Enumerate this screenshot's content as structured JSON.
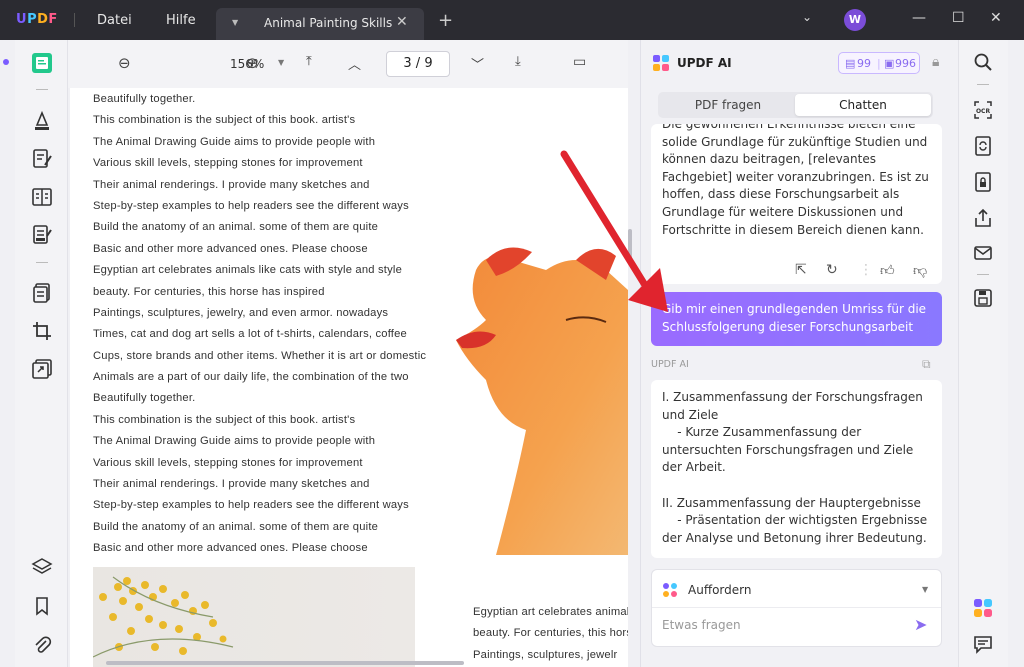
{
  "app": {
    "logo": "UPDF",
    "menus": [
      "Datei",
      "Hilfe"
    ],
    "tab_title": "Animal Painting Skills",
    "avatar_letter": "W"
  },
  "doc_toolbar": {
    "zoom": "156%",
    "page_indicator": "3 / 9"
  },
  "document": {
    "lines": [
      "Beautifully together.",
      "This combination is the subject of this book. artist's",
      "The Animal Drawing Guide aims to provide people with",
      "Various skill levels, stepping stones for improvement",
      "Their animal renderings. I provide many sketches and",
      "Step-by-step examples to help readers see the different ways",
      "Build the anatomy of an animal. some of them are quite",
      "Basic and other more advanced ones. Please choose",
      "Egyptian art celebrates animals like cats with style and style",
      "beauty. For centuries, this horse has inspired",
      "Paintings, sculptures, jewelry, and even armor. nowadays",
      "Times, cat and dog art sells a lot of t-shirts, calendars, coffee",
      "Cups, store brands and other items. Whether it is art or domestic",
      "Animals are a part of our daily life, the combination of the two",
      "Beautifully together.",
      "This combination is the subject of this book. artist's",
      "The Animal Drawing Guide aims to provide people with",
      "Various skill levels, stepping stones for improvement",
      "Their animal renderings. I provide many sketches and",
      "Step-by-step examples to help readers see the different ways",
      "Build the anatomy of an animal. some of them are quite",
      "Basic and other more advanced ones. Please choose"
    ],
    "col2_lines": [
      "Egyptian art celebrates animal",
      "beauty. For centuries, this hors",
      "Paintings, sculptures, jewelr"
    ]
  },
  "ai_panel": {
    "title": "UPDF AI",
    "quota_pdf": "99",
    "quota_chat": "996",
    "tabs": [
      "PDF fragen",
      "Chatten"
    ],
    "active_tab": "Chatten",
    "answer1": "Die gewonnenen Erkenntnisse bieten eine solide Grundlage für zukünftige Studien und können dazu beitragen, [relevantes Fachgebiet] weiter voranzubringen. Es ist zu hoffen, dass diese Forschungsarbeit als Grundlage für weitere Diskussionen und Fortschritte in diesem Bereich dienen kann.",
    "user_message": "Gib mir einen grundlegenden Umriss für die Schlussfolgerung dieser Forschungsarbeit",
    "sender_label": "UPDF AI",
    "answer2": "I. Zusammenfassung der Forschungsfragen und Ziele\n    - Kurze Zusammenfassung der untersuchten Forschungsfragen und Ziele der Arbeit.\n\nII. Zusammenfassung der Hauptergebnisse\n    - Präsentation der wichtigsten Ergebnisse der Analyse und Betonung ihrer Bedeutung.\n\nIII. Diskussion der Ergebnisse im",
    "prompt_mode": "Auffordern",
    "input_placeholder": "Etwas fragen"
  },
  "colors": {
    "titlebar": "#2b2b31",
    "accent": "#8a6cf0",
    "user_bubble": "#9a6bff",
    "arrow": "#e0242e"
  }
}
